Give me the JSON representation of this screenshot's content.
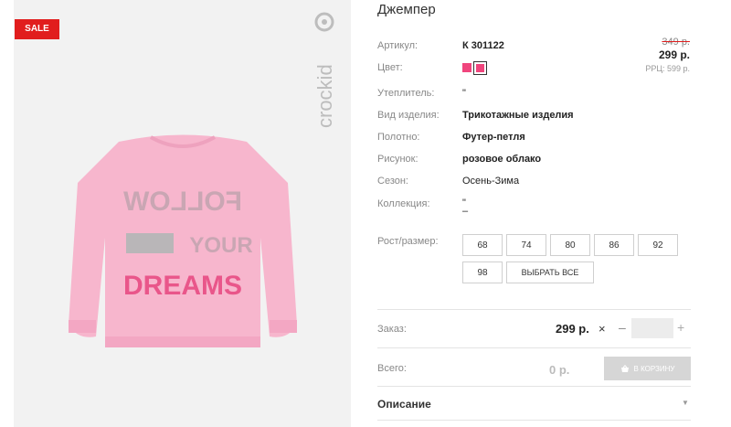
{
  "image": {
    "sale_label": "SALE",
    "brand": "crockid",
    "print_lines": [
      "FOLLOW",
      "YOUR",
      "DREAMS"
    ]
  },
  "product": {
    "title": "Джемпер",
    "old_price": "349 р.",
    "price": "299 р.",
    "rrp": "РРЦ: 599 р."
  },
  "attributes": {
    "article_label": "Артикул:",
    "article_value": "К 301122",
    "color_label": "Цвет:",
    "insulation_label": "Утеплитель:",
    "insulation_value": "\"",
    "type_label": "Вид изделия:",
    "type_value": "Трикотажные изделия",
    "fabric_label": "Полотно:",
    "fabric_value": "Футер-петля",
    "pattern_label": "Рисунок:",
    "pattern_value": "розовое облако",
    "season_label": "Сезон:",
    "season_value": "Осень-Зима",
    "collection_label": "Коллекция:",
    "collection_value_1": "\"",
    "collection_value_2": "–",
    "size_label": "Рост/размер:"
  },
  "colors": [
    "#f0457d",
    "#f0457d"
  ],
  "sizes": [
    "68",
    "74",
    "80",
    "86",
    "92",
    "98"
  ],
  "select_all_label": "ВЫБРАТЬ ВСЕ",
  "order": {
    "label": "Заказ:",
    "price": "299 р.",
    "times": "×",
    "minus": "–",
    "quantity": "",
    "plus": "+"
  },
  "total": {
    "label": "Всего:",
    "value": "0 р.",
    "cart_label": "В КОРЗИНУ"
  },
  "description": {
    "label": "Описание"
  }
}
